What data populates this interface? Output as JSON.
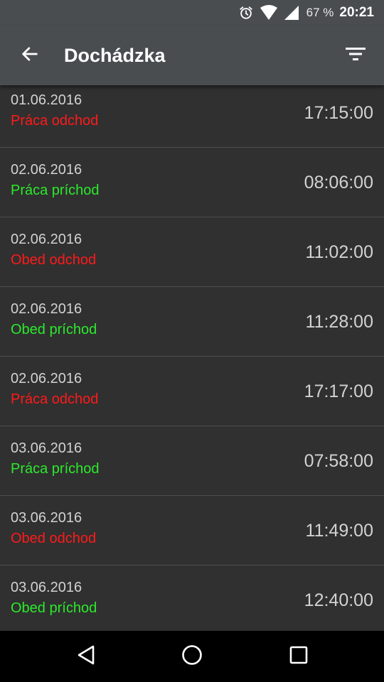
{
  "status_bar": {
    "battery_percent": "67 %",
    "time": "20:21",
    "icons": [
      "alarm-icon",
      "wifi-icon",
      "signal-icon"
    ]
  },
  "app_bar": {
    "title": "Dochádzka",
    "back_icon": "arrow-back-icon",
    "filter_icon": "filter-icon"
  },
  "colors": {
    "departure": "#ff1a1a",
    "arrival": "#2bea2b",
    "toolbar": "#4a4d50",
    "background": "#303030"
  },
  "records": [
    {
      "date": "01.06.2016",
      "type": "Práca odchod",
      "kind": "out",
      "time": "17:15:00"
    },
    {
      "date": "02.06.2016",
      "type": "Práca príchod",
      "kind": "in",
      "time": "08:06:00"
    },
    {
      "date": "02.06.2016",
      "type": "Obed odchod",
      "kind": "out",
      "time": "11:02:00"
    },
    {
      "date": "02.06.2016",
      "type": "Obed príchod",
      "kind": "in",
      "time": "11:28:00"
    },
    {
      "date": "02.06.2016",
      "type": "Práca odchod",
      "kind": "out",
      "time": "17:17:00"
    },
    {
      "date": "03.06.2016",
      "type": "Práca príchod",
      "kind": "in",
      "time": "07:58:00"
    },
    {
      "date": "03.06.2016",
      "type": "Obed odchod",
      "kind": "out",
      "time": "11:49:00"
    },
    {
      "date": "03.06.2016",
      "type": "Obed príchod",
      "kind": "in",
      "time": "12:40:00"
    }
  ],
  "nav_bar": {
    "icons": [
      "nav-back-icon",
      "nav-home-icon",
      "nav-recents-icon"
    ]
  }
}
